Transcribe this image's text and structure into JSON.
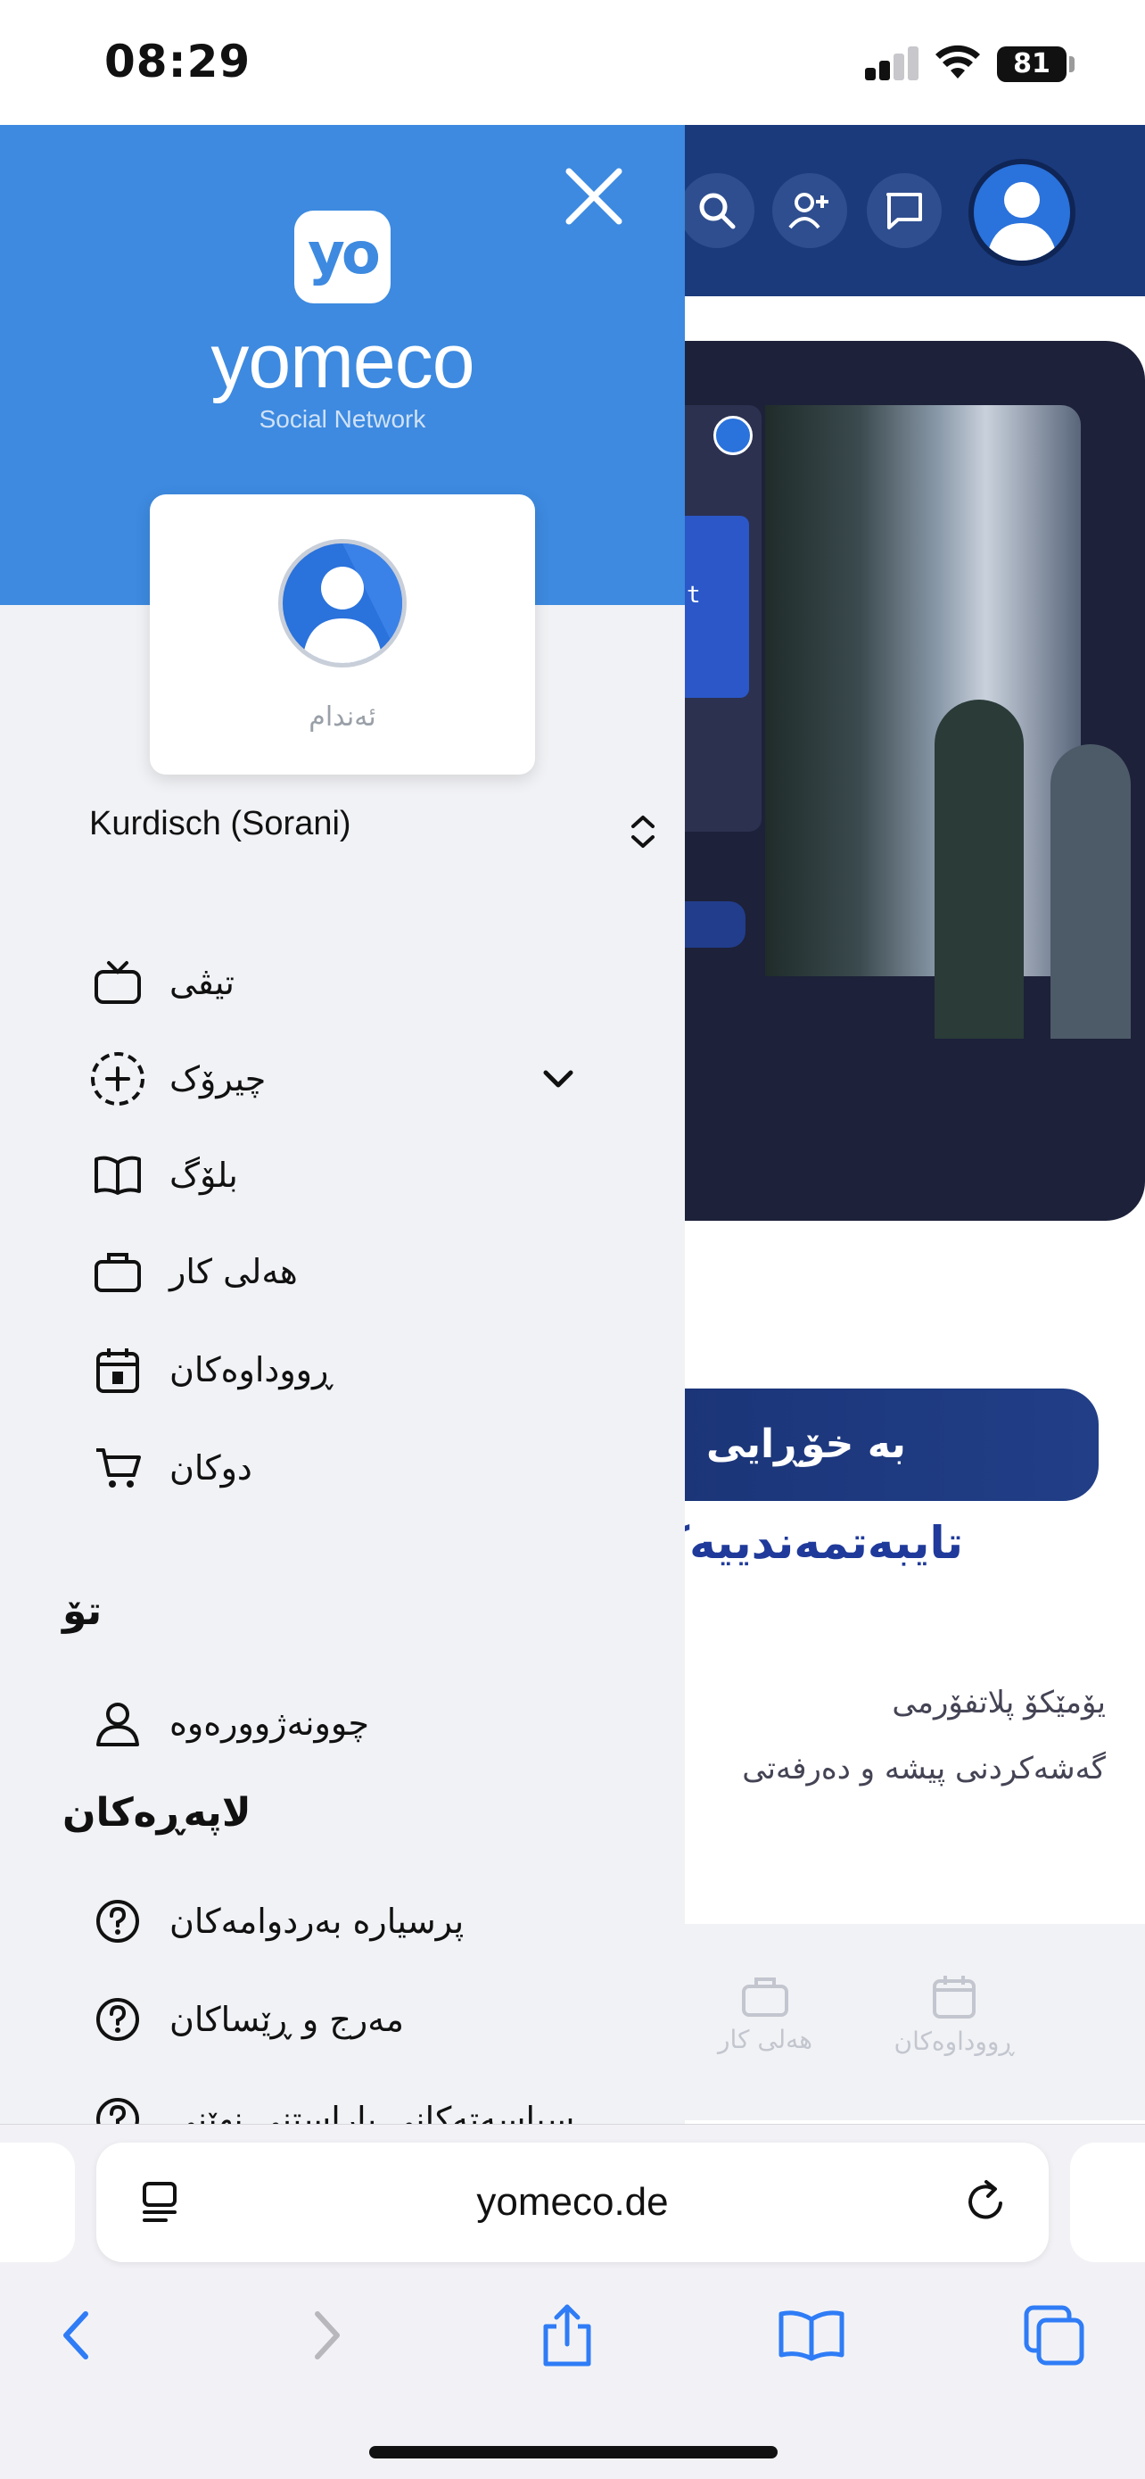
{
  "status_bar": {
    "time": "08:29",
    "battery": "81"
  },
  "drawer": {
    "logo_text": "yo",
    "brand": "yomeco",
    "tagline": "Social Network",
    "profile": {
      "role": "ئەندام"
    },
    "language": "Kurdisch (Sorani)",
    "menu": [
      {
        "label": "تیڤی",
        "icon": "tv-icon"
      },
      {
        "label": "چیرۆک",
        "icon": "story-add-icon",
        "expandable": true
      },
      {
        "label": "بلۆگ",
        "icon": "book-icon"
      },
      {
        "label": "هەلی کار",
        "icon": "briefcase-icon"
      },
      {
        "label": "ڕووداوەکان",
        "icon": "calendar-icon"
      },
      {
        "label": "دوکان",
        "icon": "cart-icon"
      }
    ],
    "section_you": "تۆ",
    "you_items": [
      {
        "label": "چوونەژوورەوە",
        "icon": "user-icon"
      }
    ],
    "section_pages": "لاپەڕەکان",
    "page_items": [
      {
        "label": "پرسیارە بەردوامەکان",
        "icon": "help-circle-icon"
      },
      {
        "label": "مەرج و ڕێساکان",
        "icon": "help-circle-icon"
      },
      {
        "label": "سیاسەتەکانی پاراستنی نهێنی",
        "icon": "help-circle-icon"
      }
    ]
  },
  "background_page": {
    "cta": "بە خۆڕایی",
    "title": "تایبەتمەندییەکان",
    "line1": "یۆمێکۆ پلاتفۆرمی",
    "line2": "گەشەکردنی پیشە و دەرفەتی",
    "tab_jobs": "هەلی کار",
    "tab_events": "ڕووداوەکان",
    "mini_text": "t"
  },
  "safari": {
    "url": "yomeco.de"
  },
  "colors": {
    "drawer_header": "#3d8ae0",
    "page_header": "#1b3a7c",
    "hero": "#1d2139",
    "accent_blue": "#2a72dc"
  }
}
